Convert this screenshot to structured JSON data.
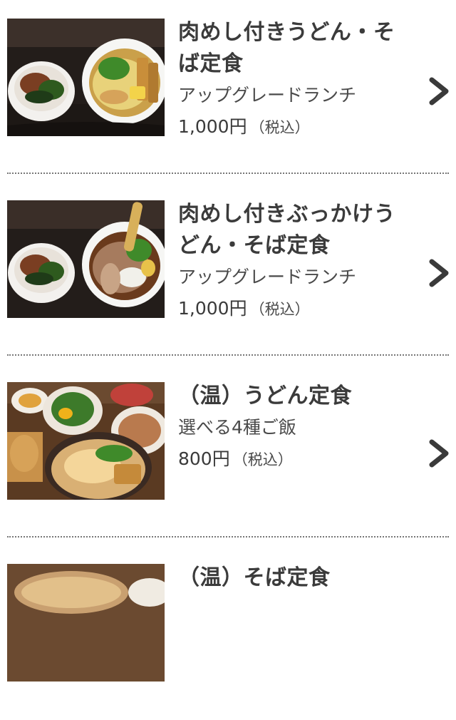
{
  "menu": {
    "items": [
      {
        "title_line1": "肉めし付きうどん・そ",
        "title_line2": "ば定食",
        "subtitle": "アップグレードランチ",
        "price": "1,000円",
        "tax": "（税込）",
        "image_icon": "udon-set-photo"
      },
      {
        "title_line1": "肉めし付きぶっかけう",
        "title_line2": "どん・そば定食",
        "subtitle": "アップグレードランチ",
        "price": "1,000円",
        "tax": "（税込）",
        "image_icon": "bukkake-set-photo"
      },
      {
        "title_line1": "（温）うどん定食",
        "subtitle": "選べる4種ご飯",
        "price": "800円",
        "tax": "（税込）",
        "image_icon": "warm-udon-set-photo"
      },
      {
        "title_line1": "（温）そば定食",
        "image_icon": "warm-soba-set-photo"
      }
    ],
    "chevron_icon": "chevron-right-icon",
    "colors": {
      "text": "#3b3b3b",
      "divider": "#777777",
      "chevron": "#3a3a3a"
    }
  }
}
